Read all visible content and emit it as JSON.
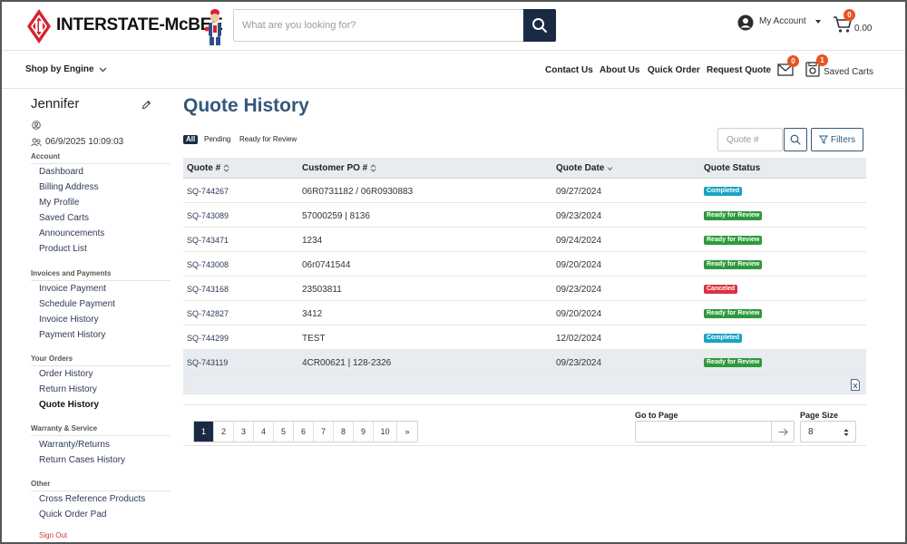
{
  "header": {
    "logo_text": "INTERSTATE-McBEE",
    "search_placeholder": "What are you looking for?",
    "account_label": "My Account",
    "cart_badge": "0",
    "cart_amount": "0.00"
  },
  "nav": {
    "shop_by_engine": "Shop by Engine",
    "links": [
      "Contact Us",
      "About Us",
      "Quick Order",
      "Request Quote"
    ],
    "messages_badge": "0",
    "saved_carts_badge": "1",
    "saved_carts_label": "Saved Carts"
  },
  "sidebar": {
    "user_name": "Jennifer",
    "last_login": "06/9/2025 10:09:03",
    "sections": {
      "account": {
        "label": "Account",
        "items": [
          "Dashboard",
          "Billing Address",
          "My Profile",
          "Saved Carts",
          "Announcements",
          "Product List"
        ]
      },
      "invoices": {
        "label": "Invoices and Payments",
        "items": [
          "Invoice Payment",
          "Schedule Payment",
          "Invoice History",
          "Payment History"
        ]
      },
      "orders": {
        "label": "Your Orders",
        "items": [
          "Order History",
          "Return History",
          "Quote History"
        ]
      },
      "warranty": {
        "label": "Warranty & Service",
        "items": [
          "Warranty/Returns",
          "Return Cases History"
        ]
      },
      "other": {
        "label": "Other",
        "items": [
          "Cross Reference Products",
          "Quick Order Pad"
        ]
      }
    },
    "sign_out": "Sign Out"
  },
  "main": {
    "title": "Quote History",
    "filter_tabs": [
      "All",
      "Pending",
      "Ready for Review"
    ],
    "quote_placeholder": "Quote #",
    "filters_label": "Filters",
    "columns": [
      "Quote #",
      "Customer PO #",
      "Quote Date",
      "Quote Status"
    ],
    "rows": [
      {
        "quote": "SQ-744267",
        "po": "06R0731182 / 06R0930883",
        "date": "09/27/2024",
        "status": "Completed"
      },
      {
        "quote": "SQ-743089",
        "po": "57000259 | 8136",
        "date": "09/23/2024",
        "status": "Ready for Review"
      },
      {
        "quote": "SQ-743471",
        "po": "1234",
        "date": "09/24/2024",
        "status": "Ready for Review"
      },
      {
        "quote": "SQ-743008",
        "po": "06r0741544",
        "date": "09/20/2024",
        "status": "Ready for Review"
      },
      {
        "quote": "SQ-743168",
        "po": "23503811",
        "date": "09/23/2024",
        "status": "Canceled"
      },
      {
        "quote": "SQ-742827",
        "po": "3412",
        "date": "09/20/2024",
        "status": "Ready for Review"
      },
      {
        "quote": "SQ-744299",
        "po": "TEST",
        "date": "12/02/2024",
        "status": "Completed"
      },
      {
        "quote": "SQ-743119",
        "po": "4CR00621 | 128-2326",
        "date": "09/23/2024",
        "status": "Ready for Review"
      }
    ],
    "status_colors": {
      "Completed": "#1aa3c2",
      "Ready for Review": "#2d9a3c",
      "Canceled": "#d9333f"
    },
    "pager": {
      "pages": [
        "1",
        "2",
        "3",
        "4",
        "5",
        "6",
        "7",
        "8",
        "9",
        "10"
      ],
      "next": "»",
      "goto_label": "Go to Page",
      "page_size_label": "Page Size",
      "page_size": "8"
    }
  },
  "colors": {
    "brand_navy": "#1b2a44",
    "title_blue": "#33587a",
    "badge_orange": "#e8541e",
    "logo_red": "#d7232f"
  }
}
